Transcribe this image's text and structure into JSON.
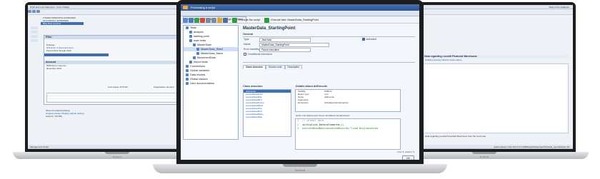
{
  "left_laptop": {
    "title": "Profit and Loss Statement - Cost of Sales",
    "window_controls": "Standard Do",
    "tree_rows": [
      "OTHER OPERATING EXPENSES",
      "OCCUPANCY EXPENSES",
      "Bldg Rent expense"
    ],
    "popup": {
      "filter_label": "Filter",
      "postings_label": "Postings",
      "drill_link": "Drill down to document level",
      "range_text": "Period 2013 through 2013",
      "heading": "Account",
      "lines": [
        "5300 Room expense",
        "December 2013"
      ],
      "cost_status": "Cost status: ACTUAL",
      "org_label": "Organisation element"
    },
    "bottom_rows": [
      "Show an ordered posting",
      "Original posting: Display original posting",
      "Amount: 716,550"
    ],
    "footer": "Management Script"
  },
  "center_window": {
    "title": "Processing a script",
    "tabs": [
      "GOSUZ.BDA.FETILPoint",
      "Change password"
    ],
    "toolbar": {
      "execute_label": "Execute the script",
      "execute_fast_label": "Execute fast: MasterData_StartingPoint"
    },
    "tree": [
      {
        "label": "Tests",
        "depth": 0
      },
      {
        "label": "analysis",
        "depth": 1
      },
      {
        "label": "starting point",
        "depth": 1
      },
      {
        "label": "main tests",
        "depth": 1
      },
      {
        "label": "MasterData",
        "depth": 2
      },
      {
        "label": "MasterData_Starti",
        "depth": 3,
        "selected": true
      },
      {
        "label": "MasterData_Maxo",
        "depth": 3
      },
      {
        "label": "MovementData",
        "depth": 2
      },
      {
        "label": "Import tests",
        "depth": 1
      },
      {
        "label": "Connections",
        "depth": 0
      },
      {
        "label": "Global variables",
        "depth": 0
      },
      {
        "label": "Data models",
        "depth": 0
      },
      {
        "label": "Global classes",
        "depth": 0
      },
      {
        "label": "User documentation",
        "depth": 0
      }
    ],
    "detail": {
      "heading": "MasterData_StartingPoint",
      "general_section": "General",
      "fields": [
        {
          "label": "Type",
          "value": "Java task"
        },
        {
          "label": "Name",
          "value": "MasterData_StartingPoint"
        },
        {
          "label": "Error handling",
          "value": "Pause execution"
        }
      ],
      "activated_label": "activated",
      "conditional_label": "Conditional execution",
      "subtabs": [
        "Class structure",
        "Source code",
        "Description"
      ],
      "class_structure_title": "Class structure",
      "class_items": [
        "doExecute",
        "executeReadCont",
        "executeReadDat",
        "executeReadFinl",
        "executeReadComp",
        "executeReadMast",
        "executeReadOrg",
        "executeReadProf",
        "executeReadRepo",
        "executeReadStat"
      ],
      "details_title": "Details about  doExecute",
      "details": [
        {
          "key": "Visibility",
          "value": "PUBLIC"
        },
        {
          "key": "Return type",
          "value": "void"
        },
        {
          "key": "Name",
          "value": "doExecute"
        },
        {
          "key": "Arguments",
          "value": ""
        },
        {
          "key": "Exceptions",
          "value": "ScriptExecutionException"
        }
      ],
      "code_caption": "public void doExecute() throws ScriptExecutionException",
      "code_lines": [
        {
          "n": "1",
          "text": "// global data"
        },
        {
          "n": "2",
          "text": "initialize_Datenelemente();"
        },
        {
          "n": "3",
          "text": "executeReadBusinessAreaRecords(\"Load BusinessArea"
        }
      ],
      "cursor_pos": "Line: 5, column: 3",
      "ok_label": "OK"
    }
  },
  "right_laptop": {
    "title": "State of the database",
    "header": "Data regarding Lucebit Financial Warehouse",
    "link": "Auditing opening balance sheet values",
    "status_text": "Data regarding Lucebit Financial Warehouse from the input note",
    "footer": "date/rundown: http://127.0.0.1:8080/sap/bc/bsp/sap/zfinancial_reports/index.htm"
  },
  "brand_label": "MacBook",
  "colors": {
    "accent": "#2d5491",
    "selection": "#3c6fb6",
    "bezel": "#1c1d20"
  }
}
